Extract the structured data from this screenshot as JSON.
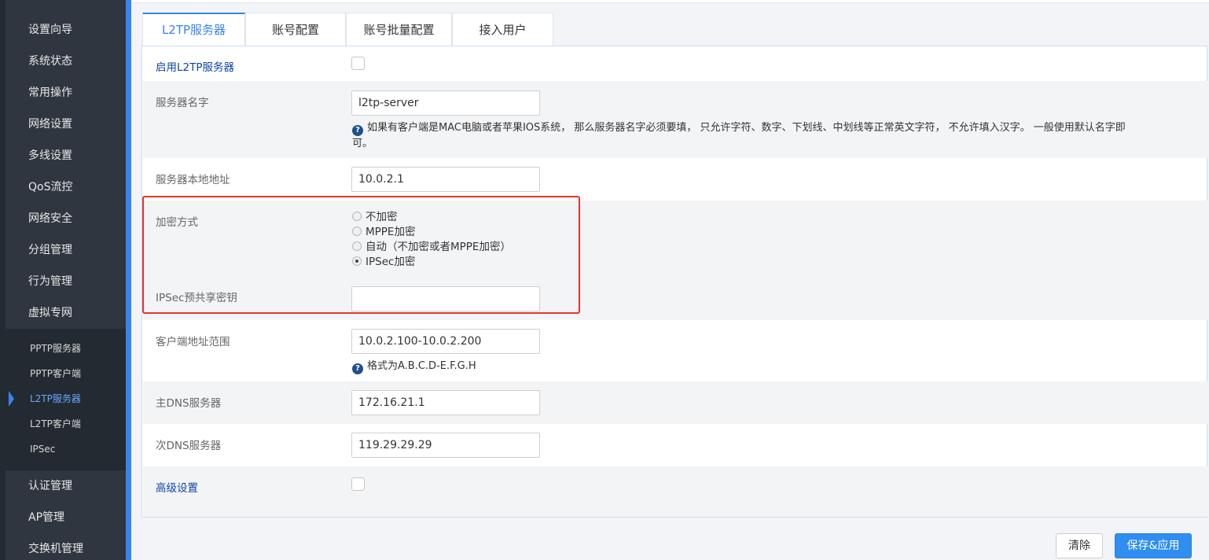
{
  "sidebar": {
    "items": [
      {
        "label": "设置向导"
      },
      {
        "label": "系统状态"
      },
      {
        "label": "常用操作"
      },
      {
        "label": "网络设置"
      },
      {
        "label": "多线设置"
      },
      {
        "label": "QoS流控"
      },
      {
        "label": "网络安全"
      },
      {
        "label": "分组管理"
      },
      {
        "label": "行为管理"
      },
      {
        "label": "虚拟专网"
      }
    ],
    "submenu": [
      {
        "label": "PPTP服务器"
      },
      {
        "label": "PPTP客户端"
      },
      {
        "label": "L2TP服务器"
      },
      {
        "label": "L2TP客户端"
      },
      {
        "label": "IPSec"
      }
    ],
    "items_after": [
      {
        "label": "认证管理"
      },
      {
        "label": "AP管理"
      },
      {
        "label": "交换机管理"
      }
    ]
  },
  "tabs": [
    {
      "label": "L2TP服务器"
    },
    {
      "label": "账号配置"
    },
    {
      "label": "账号批量配置"
    },
    {
      "label": "接入用户"
    }
  ],
  "form": {
    "enable_label": "启用L2TP服务器",
    "server_name_label": "服务器名字",
    "server_name_value": "l2tp-server",
    "server_name_help_line1": "如果有客户端是MAC电脑或者苹果IOS系统， 那么服务器名字必须要填， 只允许字符、数字、下划线、中划线等正常英文字符， 不允许填入汉字。 一般使用默认名字即",
    "server_name_help_line2": "可。",
    "local_addr_label": "服务器本地地址",
    "local_addr_value": "10.0.2.1",
    "encryption_label": "加密方式",
    "encryption_options": [
      {
        "label": "不加密",
        "checked": false
      },
      {
        "label": "MPPE加密",
        "checked": false
      },
      {
        "label": "自动（不加密或者MPPE加密）",
        "checked": false
      },
      {
        "label": "IPSec加密",
        "checked": true
      }
    ],
    "ipsec_psk_label": "IPSec预共享密钥",
    "ipsec_psk_value": "",
    "client_range_label": "客户端地址范围",
    "client_range_value": "10.0.2.100-10.0.2.200",
    "client_range_help": "格式为A.B.C.D-E.F.G.H",
    "dns1_label": "主DNS服务器",
    "dns1_value": "172.16.21.1",
    "dns2_label": "次DNS服务器",
    "dns2_value": "119.29.29.29",
    "advanced_label": "高级设置"
  },
  "buttons": {
    "clear": "清除",
    "save": "保存&应用"
  },
  "colors": {
    "accent": "#3a84f0",
    "sidebar_bg": "#2f3640",
    "highlight": "#e8322f"
  }
}
